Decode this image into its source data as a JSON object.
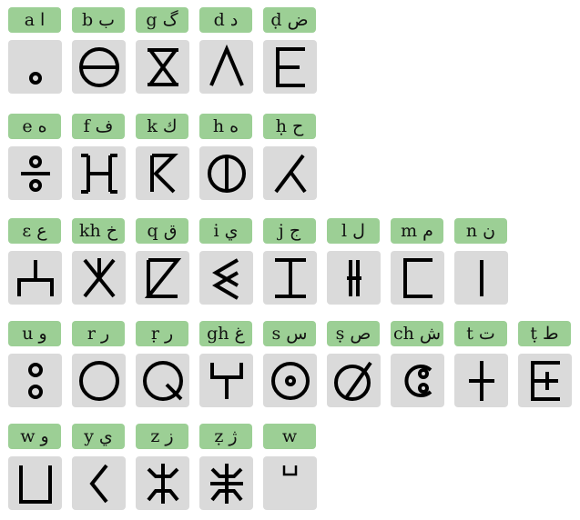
{
  "letters": [
    {
      "latin": "a",
      "arabic": "ا",
      "glyph": "ya"
    },
    {
      "latin": "b",
      "arabic": "ب",
      "glyph": "yab"
    },
    {
      "latin": "g",
      "arabic": "گ",
      "glyph": "yag"
    },
    {
      "latin": "d",
      "arabic": "د",
      "glyph": "yad"
    },
    {
      "latin": "ḍ",
      "arabic": "ض",
      "glyph": "yadd"
    },
    {
      "latin": "e",
      "arabic": "ه",
      "glyph": "yey"
    },
    {
      "latin": "f",
      "arabic": "ف",
      "glyph": "yaf"
    },
    {
      "latin": "k",
      "arabic": "ك",
      "glyph": "yak"
    },
    {
      "latin": "h",
      "arabic": "ه",
      "glyph": "yah"
    },
    {
      "latin": "ḥ",
      "arabic": "ح",
      "glyph": "yahh"
    },
    {
      "latin": "ɛ",
      "arabic": "ع",
      "glyph": "yaa"
    },
    {
      "latin": "kh",
      "arabic": "خ",
      "glyph": "yakh"
    },
    {
      "latin": "q",
      "arabic": "ق",
      "glyph": "yaq"
    },
    {
      "latin": "i",
      "arabic": "ي",
      "glyph": "yi"
    },
    {
      "latin": "j",
      "arabic": "ج",
      "glyph": "yaj"
    },
    {
      "latin": "l",
      "arabic": "ل",
      "glyph": "yal"
    },
    {
      "latin": "m",
      "arabic": "م",
      "glyph": "yam"
    },
    {
      "latin": "n",
      "arabic": "ن",
      "glyph": "yan"
    },
    {
      "latin": "u",
      "arabic": "و",
      "glyph": "yu"
    },
    {
      "latin": "r",
      "arabic": "ر",
      "glyph": "yar"
    },
    {
      "latin": "ṛ",
      "arabic": "ر",
      "glyph": "yarr"
    },
    {
      "latin": "gh",
      "arabic": "غ",
      "glyph": "yagh"
    },
    {
      "latin": "s",
      "arabic": "س",
      "glyph": "yas"
    },
    {
      "latin": "ṣ",
      "arabic": "ص",
      "glyph": "yass"
    },
    {
      "latin": "ch",
      "arabic": "ش",
      "glyph": "yach"
    },
    {
      "latin": "t",
      "arabic": "ت",
      "glyph": "yat"
    },
    {
      "latin": "ṭ",
      "arabic": "ط",
      "glyph": "yatt"
    },
    {
      "latin": "w",
      "arabic": "و",
      "glyph": "yaw"
    },
    {
      "latin": "y",
      "arabic": "ي",
      "glyph": "yay"
    },
    {
      "latin": "z",
      "arabic": "ز",
      "glyph": "yaz"
    },
    {
      "latin": "ẓ",
      "arabic": "ژ",
      "glyph": "yazz"
    },
    {
      "latin": "w",
      "arabic": "",
      "glyph": "labio-velarization-mark"
    }
  ]
}
